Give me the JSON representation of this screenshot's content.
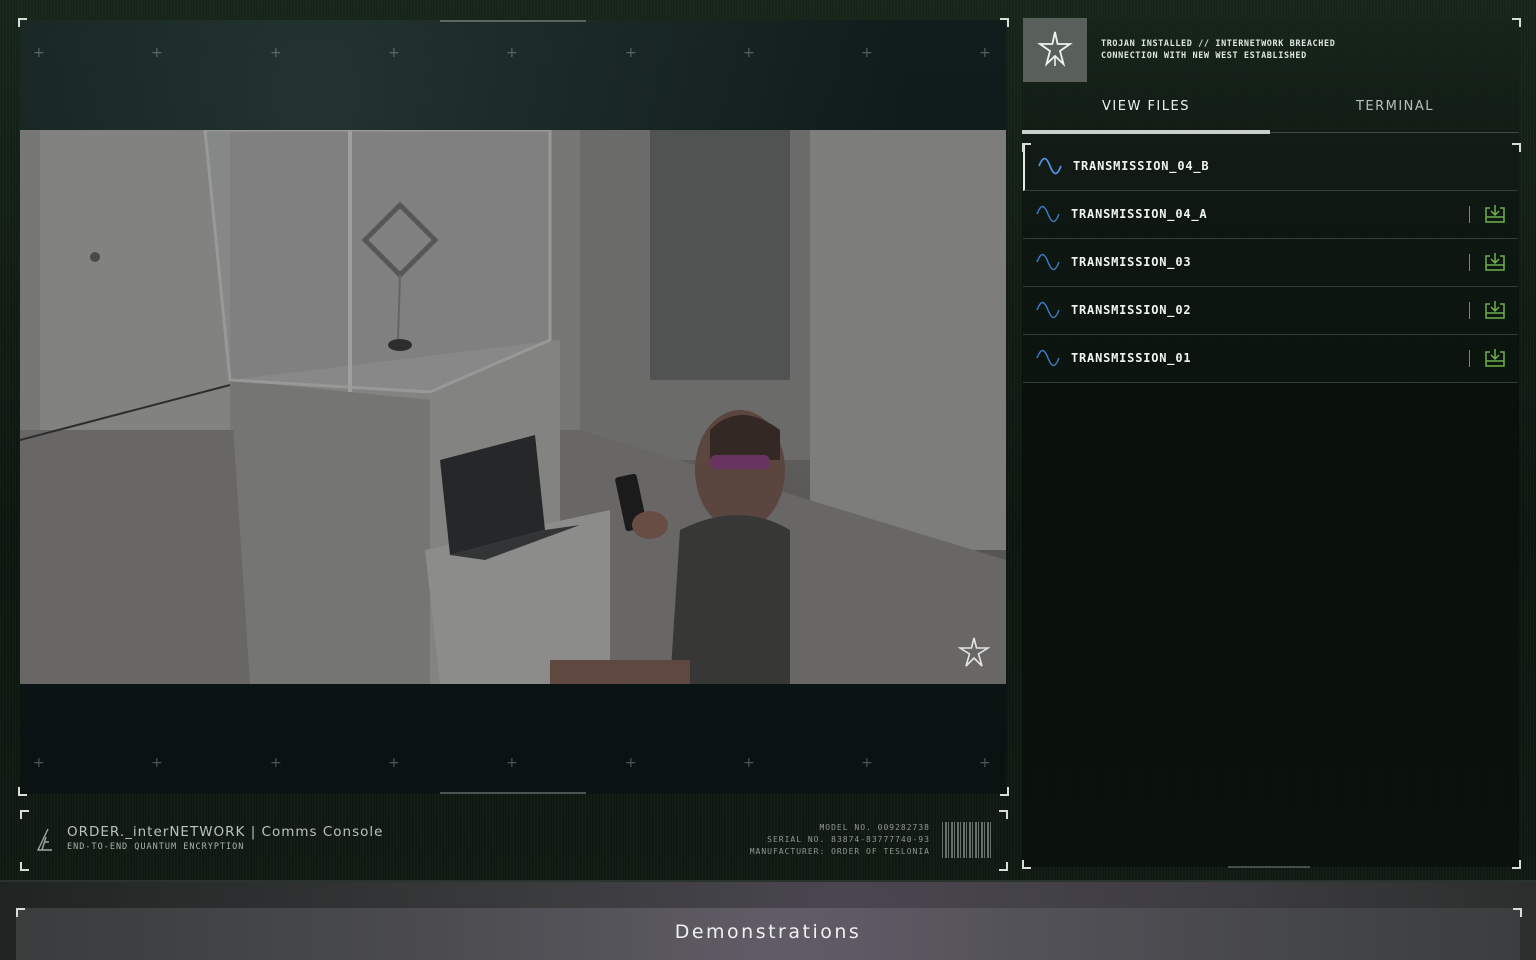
{
  "status": {
    "line1": "TROJAN INSTALLED // INTERNETWORK BREACHED",
    "line2": "CONNECTION WITH NEW WEST ESTABLISHED"
  },
  "tabs": [
    {
      "label": "VIEW FILES",
      "active": true
    },
    {
      "label": "TERMINAL",
      "active": false
    }
  ],
  "files": [
    {
      "name": "TRANSMISSION_04_B",
      "active": true
    },
    {
      "name": "TRANSMISSION_04_A",
      "active": false
    },
    {
      "name": "TRANSMISSION_03",
      "active": false
    },
    {
      "name": "TRANSMISSION_02",
      "active": false
    },
    {
      "name": "TRANSMISSION_01",
      "active": false
    }
  ],
  "footer": {
    "title": "ORDER._interNETWORK | Comms Console",
    "subtitle": "END-TO-END QUANTUM ENCRYPTION",
    "model": "MODEL NO. 009282738",
    "serial": "SERIAL NO. 83874-83777740-93",
    "manufacturer": "MANUFACTURER: ORDER OF TESLONIA"
  },
  "bottom_button": "Demonstrations",
  "icons": {
    "logo": "star-logo-icon",
    "file": "wave-icon",
    "download": "download-icon"
  },
  "colors": {
    "wave_active": "#4d8fe0",
    "wave_inactive": "#3f78c0",
    "download": "#6fb04a"
  }
}
